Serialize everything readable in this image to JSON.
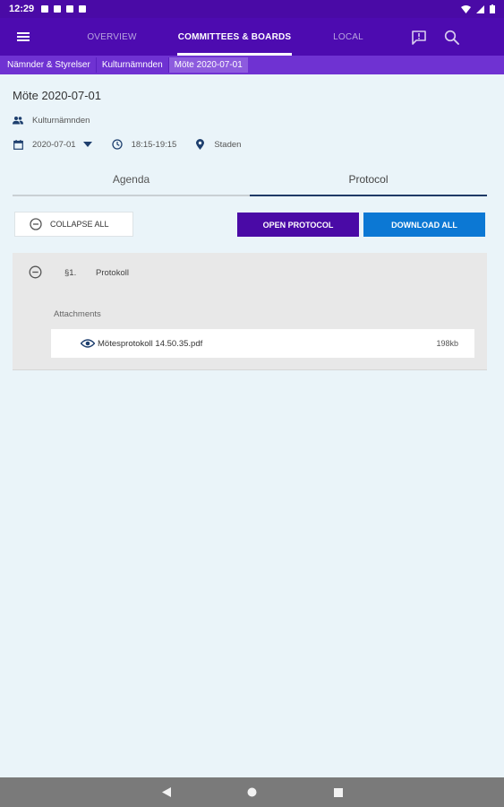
{
  "status_bar": {
    "time": "12:29"
  },
  "app_bar": {
    "tabs": [
      {
        "label": "OVERVIEW",
        "active": false
      },
      {
        "label": "COMMITTEES & BOARDS",
        "active": true
      },
      {
        "label": "LOCAL",
        "active": false
      }
    ],
    "actions": [
      "chat-icon",
      "search-icon"
    ]
  },
  "breadcrumb": [
    "Nämnder & Styrelser",
    "Kulturnämnden",
    "Möte  2020-07-01"
  ],
  "meeting": {
    "title": "Möte  2020-07-01",
    "committee": "Kulturnämnden",
    "date": "2020-07-01",
    "time": "18:15-19:15",
    "location": "Staden"
  },
  "view_tabs": [
    {
      "label": "Agenda",
      "active": false
    },
    {
      "label": "Protocol",
      "active": true
    }
  ],
  "actions": {
    "collapse_all": "COLLAPSE ALL",
    "open_protocol": "OPEN PROTOCOL",
    "download_all": "DOWNLOAD ALL"
  },
  "agenda_items": [
    {
      "number": "§1.",
      "title": "Protokoll",
      "attachments_label": "Attachments",
      "attachments": [
        {
          "name": "Mötesprotokoll  14.50.35.pdf",
          "size": "198kb"
        }
      ]
    }
  ],
  "colors": {
    "primary": "#4d0bb0",
    "breadcrumb": "#6f32d2",
    "download": "#0c78d4",
    "background": "#eaf4f9"
  }
}
